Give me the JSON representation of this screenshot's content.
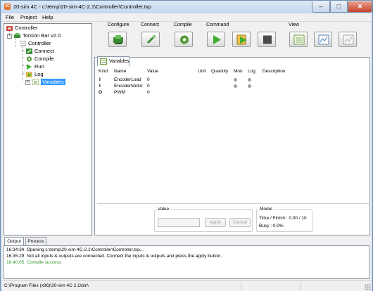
{
  "window": {
    "title": "20-sim 4C - c:\\temp\\20-sim-4C-2.1\\Controller\\Controller.txp",
    "app_icon_text": "4C",
    "minimize_glyph": "–",
    "maximize_glyph": "□",
    "close_glyph": "✕"
  },
  "menu": {
    "items": [
      "File",
      "Project",
      "Help"
    ]
  },
  "tree": {
    "root": "Controller",
    "target": "Torsion Bar v2.0",
    "node": "Controller",
    "children": [
      "Connect",
      "Compile",
      "Run",
      "Log",
      "Variables"
    ],
    "selected": "Variables",
    "expander_glyph": "+"
  },
  "toolbar": {
    "groups": {
      "configure": "Configure",
      "connect": "Connect",
      "compile": "Compile",
      "command": "Command",
      "view": "View"
    },
    "icons": {
      "configure": "board-icon",
      "connect": "connector-icon",
      "compile": "gear-icon",
      "run": "play-icon",
      "monitor": "play-log-icon",
      "stop": "stop-icon",
      "view_variables": "variables-view-icon",
      "view_plot": "plot-view-icon",
      "view_plot2": "plot-view-disabled-icon"
    }
  },
  "variables": {
    "tab_label": "Variables",
    "columns": [
      "Kind",
      "Name",
      "Value",
      "Unit",
      "Quantity",
      "Mon",
      "Log",
      "Description"
    ],
    "rows": [
      {
        "kind": "I",
        "name": "EncoderLoad",
        "value": "0"
      },
      {
        "kind": "I",
        "name": "EncoderMotor",
        "value": "0"
      },
      {
        "kind": "O",
        "name": "PWM",
        "value": "0"
      }
    ]
  },
  "value_group": {
    "title": "Value",
    "input_value": "",
    "apply": "Apply",
    "cancel": "Cancel"
  },
  "model_group": {
    "title": "Model",
    "time_finish": "Time / Finish : 0.00 / 10",
    "busy": "Busy : 0.0%"
  },
  "output": {
    "tabs": [
      "Output",
      "Process"
    ],
    "active_tab": "Output",
    "lines": [
      {
        "time": "16:34:34",
        "text": "Opening c:\\temp\\20-sim-4C-2.1\\Controller\\Controller.txp...",
        "color": "#000000"
      },
      {
        "time": "16:35:29",
        "text": "Not all inputs & outputs are connected. Connect the inputs & outputs and press the apply button.",
        "color": "#000000"
      },
      {
        "time": "16:40:05",
        "text": "Compile success",
        "color": "#2e9a2e"
      }
    ]
  },
  "status": {
    "path": "C:\\Program Files (x86)\\20-sim 4C 2.1\\bin\\"
  },
  "colors": {
    "accent_selection": "#3399ff",
    "success_text": "#2e9a2e",
    "run_green": "#3fae2e"
  }
}
